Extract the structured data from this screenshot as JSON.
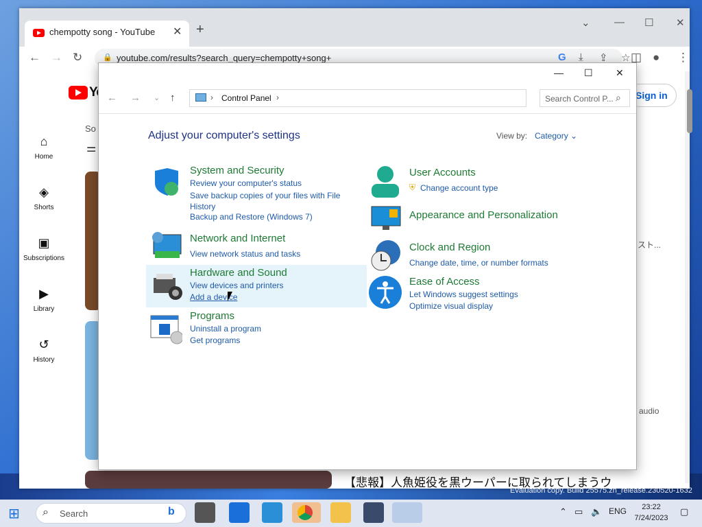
{
  "browser": {
    "tab_title": "chempotty song - YouTube",
    "url": "youtube.com/results?search_query=chempotty+song+"
  },
  "youtube": {
    "logo_text": "Yo",
    "sign_in": "Sign in",
    "search_label": "So",
    "sidebar": [
      {
        "label": "Home",
        "icon": "home-icon"
      },
      {
        "label": "Shorts",
        "icon": "shorts-icon"
      },
      {
        "label": "Subscriptions",
        "icon": "subscriptions-icon"
      },
      {
        "label": "Library",
        "icon": "library-icon"
      },
      {
        "label": "History",
        "icon": "history-icon"
      }
    ],
    "partial_text_1": "スト...",
    "partial_text_2": "audio",
    "video_title": "【悲報】人魚姫役を黒ウーパーに取られてしまうウ"
  },
  "control_panel": {
    "address": "Control Panel",
    "search_placeholder": "Search Control P...",
    "heading": "Adjust your computer's settings",
    "view_by_label": "View by:",
    "view_by_value": "Category",
    "categories": [
      {
        "title": "System and Security",
        "links": [
          "Review your computer's status",
          "Save backup copies of your files with File History",
          "Backup and Restore (Windows 7)"
        ]
      },
      {
        "title": "Network and Internet",
        "links": [
          "View network status and tasks"
        ]
      },
      {
        "title": "Hardware and Sound",
        "links": [
          "View devices and printers",
          "Add a device"
        ]
      },
      {
        "title": "Programs",
        "links": [
          "Uninstall a program",
          "Get programs"
        ]
      },
      {
        "title": "User Accounts",
        "links": [
          "Change account type"
        ]
      },
      {
        "title": "Appearance and Personalization",
        "links": []
      },
      {
        "title": "Clock and Region",
        "links": [
          "Change date, time, or number formats"
        ]
      },
      {
        "title": "Ease of Access",
        "links": [
          "Let Windows suggest settings",
          "Optimize visual display"
        ]
      }
    ]
  },
  "taskbar": {
    "search": "Search",
    "language": "ENG",
    "time": "23:22",
    "date": "7/24/2023",
    "eval_text": "Evaluation copy. Build 25575.zn_release.230520-1632"
  },
  "colors": {
    "link": "#1e5aa8",
    "category_title": "#1e7a34",
    "heading": "#1e3287",
    "hover_bg": "#e5f3fb"
  }
}
